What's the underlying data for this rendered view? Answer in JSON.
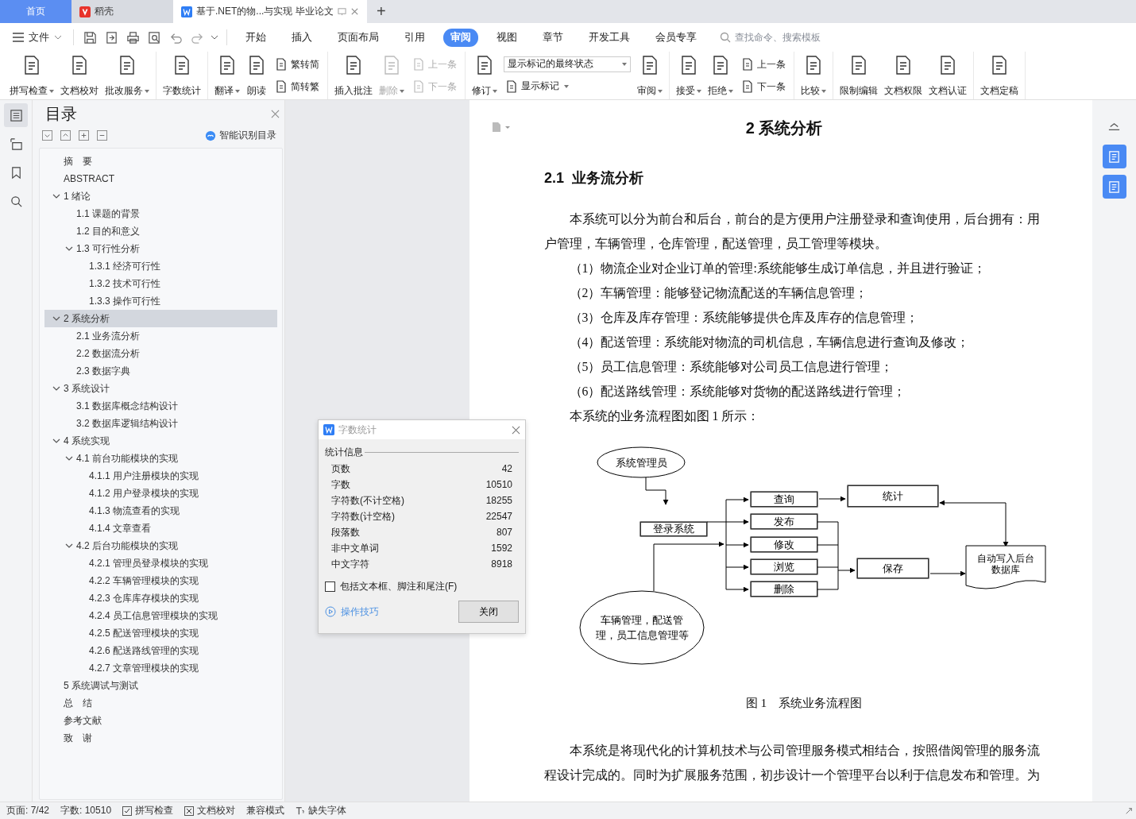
{
  "tab_bar": {
    "tabs": [
      {
        "label": "首页",
        "kind": "home",
        "selected": false
      },
      {
        "label": "稻壳",
        "kind": "app",
        "selected": false
      },
      {
        "label": "基于.NET的物...与实现 毕业论文",
        "kind": "doc",
        "selected": true
      }
    ],
    "new_tab": "+"
  },
  "menu_bar": {
    "file": "文件",
    "tabs": [
      {
        "label": "开始",
        "selected": false
      },
      {
        "label": "插入",
        "selected": false
      },
      {
        "label": "页面布局",
        "selected": false
      },
      {
        "label": "引用",
        "selected": false
      },
      {
        "label": "审阅",
        "selected": true
      },
      {
        "label": "视图",
        "selected": false
      },
      {
        "label": "章节",
        "selected": false
      },
      {
        "label": "开发工具",
        "selected": false
      },
      {
        "label": "会员专享",
        "selected": false
      }
    ],
    "search": {
      "placeholder": "查找命令、搜索模板"
    }
  },
  "ribbon": {
    "groups": [
      {
        "items": [
          {
            "kind": "large",
            "label": "拼写检查",
            "dropdown": true,
            "disabled": false
          },
          {
            "kind": "large",
            "label": "文档校对",
            "dropdown": false,
            "disabled": false
          },
          {
            "kind": "large",
            "label": "批改服务",
            "dropdown": true,
            "disabled": false
          }
        ]
      },
      {
        "items": [
          {
            "kind": "large",
            "label": "字数统计",
            "dropdown": false,
            "disabled": false
          }
        ]
      },
      {
        "items": [
          {
            "kind": "large",
            "label": "翻译",
            "dropdown": true,
            "disabled": false
          },
          {
            "kind": "large",
            "label": "朗读",
            "dropdown": false,
            "disabled": false
          },
          {
            "kind": "stack",
            "items": [
              {
                "kind": "small",
                "label": "繁转简",
                "dropdown": false,
                "disabled": false
              },
              {
                "kind": "small",
                "label": "简转繁",
                "dropdown": false,
                "disabled": false
              }
            ]
          }
        ]
      },
      {
        "items": [
          {
            "kind": "large",
            "label": "插入批注",
            "dropdown": false,
            "disabled": false
          },
          {
            "kind": "large",
            "label": "删除",
            "dropdown": true,
            "disabled": true
          },
          {
            "kind": "stack",
            "items": [
              {
                "kind": "small",
                "label": "上一条",
                "dropdown": false,
                "disabled": true
              },
              {
                "kind": "small",
                "label": "下一条",
                "dropdown": false,
                "disabled": true
              }
            ]
          }
        ]
      },
      {
        "items": [
          {
            "kind": "large",
            "label": "修订",
            "dropdown": true,
            "disabled": false
          },
          {
            "kind": "stack",
            "items": [
              {
                "kind": "select",
                "label": "显示标记的最终状态",
                "dropdown": true,
                "disabled": false
              },
              {
                "kind": "small",
                "label": "显示标记",
                "dropdown": true,
                "disabled": false
              }
            ]
          },
          {
            "kind": "large",
            "label": "审阅",
            "dropdown": true,
            "disabled": false
          }
        ]
      },
      {
        "items": [
          {
            "kind": "large",
            "label": "接受",
            "dropdown": true,
            "disabled": false
          },
          {
            "kind": "large",
            "label": "拒绝",
            "dropdown": true,
            "disabled": false
          },
          {
            "kind": "stack",
            "items": [
              {
                "kind": "small",
                "label": "上一条",
                "dropdown": false,
                "disabled": false
              },
              {
                "kind": "small",
                "label": "下一条",
                "dropdown": false,
                "disabled": false
              }
            ]
          }
        ]
      },
      {
        "items": [
          {
            "kind": "large",
            "label": "比较",
            "dropdown": true,
            "disabled": false
          }
        ]
      },
      {
        "items": [
          {
            "kind": "large",
            "label": "限制编辑",
            "dropdown": false,
            "disabled": false
          },
          {
            "kind": "large",
            "label": "文档权限",
            "dropdown": false,
            "disabled": false
          },
          {
            "kind": "large",
            "label": "文档认证",
            "dropdown": false,
            "disabled": false
          }
        ]
      },
      {
        "items": [
          {
            "kind": "large",
            "label": "文档定稿",
            "dropdown": false,
            "disabled": false
          }
        ]
      }
    ]
  },
  "left_rail": {
    "items": [
      {
        "selected": true
      },
      {
        "selected": false
      },
      {
        "selected": false
      },
      {
        "selected": false
      }
    ]
  },
  "toc": {
    "title": "目录",
    "smart_button": "智能识别目录",
    "items": [
      {
        "label": "摘　要",
        "selected": false
      },
      {
        "label": "ABSTRACT",
        "selected": false
      },
      {
        "label": "1 绪论",
        "selected": false,
        "expanded": true,
        "children": [
          {
            "label": "1.1  课题的背景",
            "selected": false
          },
          {
            "label": "1.2  目的和意义",
            "selected": false
          },
          {
            "label": "1.3  可行性分析",
            "selected": false,
            "expanded": true,
            "children": [
              {
                "label": "1.3.1 经济可行性",
                "selected": false
              },
              {
                "label": "1.3.2 技术可行性",
                "selected": false
              },
              {
                "label": "1.3.3 操作可行性",
                "selected": false
              }
            ]
          }
        ]
      },
      {
        "label": "2 系统分析",
        "selected": true,
        "expanded": true,
        "children": [
          {
            "label": "2.1  业务流分析",
            "selected": false
          },
          {
            "label": "2.2  数据流分析",
            "selected": false
          },
          {
            "label": "2.3  数据字典",
            "selected": false
          }
        ]
      },
      {
        "label": "3 系统设计",
        "selected": false,
        "expanded": true,
        "children": [
          {
            "label": "3.1 数据库概念结构设计",
            "selected": false
          },
          {
            "label": "3.2  数据库逻辑结构设计",
            "selected": false
          }
        ]
      },
      {
        "label": "4 系统实现",
        "selected": false,
        "expanded": true,
        "children": [
          {
            "label": "4.1 前台功能模块的实现",
            "selected": false,
            "expanded": true,
            "children": [
              {
                "label": "4.1.1  用户注册模块的实现",
                "selected": false
              },
              {
                "label": "4.1.2  用户登录模块的实现",
                "selected": false
              },
              {
                "label": "4.1.3  物流查看的实现",
                "selected": false
              },
              {
                "label": "4.1.4  文章查看",
                "selected": false
              }
            ]
          },
          {
            "label": "4.2 后台功能模块的实现",
            "selected": false,
            "expanded": true,
            "children": [
              {
                "label": "4.2.1  管理员登录模块的实现",
                "selected": false
              },
              {
                "label": "4.2.2  车辆管理模块的实现",
                "selected": false
              },
              {
                "label": "4.2.3  仓库库存模块的实现",
                "selected": false
              },
              {
                "label": "4.2.4  员工信息管理模块的实现",
                "selected": false
              },
              {
                "label": "4.2.5  配送管理模块的实现",
                "selected": false
              },
              {
                "label": "4.2.6  配送路线管理的实现",
                "selected": false
              },
              {
                "label": "4.2.7  文章管理模块的实现",
                "selected": false
              }
            ]
          }
        ]
      },
      {
        "label": "5  系统调试与测试",
        "selected": false
      },
      {
        "label": "总　结",
        "selected": false
      },
      {
        "label": "参考文献",
        "selected": false
      },
      {
        "label": "致　谢",
        "selected": false
      }
    ]
  },
  "document": {
    "heading": "2 系统分析",
    "section": {
      "number": "2.1",
      "title": "业务流分析"
    },
    "paragraphs": [
      "本系统可以分为前台和后台，前台的是方便用户注册登录和查询使用，后台拥有：用户管理，车辆管理，仓库管理，配送管理，员工管理等模块。",
      "（1）物流企业对企业订单的管理:系统能够生成订单信息，并且进行验证；",
      "（2）车辆管理：能够登记物流配送的车辆信息管理；",
      "（3）仓库及库存管理：系统能够提供仓库及库存的信息管理；",
      "（4）配送管理：系统能对物流的司机信息，车辆信息进行查询及修改；",
      "（5）员工信息管理：系统能够对公司员工信息进行管理；",
      "（6）配送路线管理：系统能够对货物的配送路线进行管理；",
      "本系统的业务流程图如图 1 所示："
    ],
    "flowchart": {
      "nodes": [
        {
          "kind": "ellipse",
          "label": "系统管理员"
        },
        {
          "kind": "box",
          "label": "登录系统"
        },
        {
          "kind": "box",
          "label": "查询"
        },
        {
          "kind": "box",
          "label": "发布"
        },
        {
          "kind": "box",
          "label": "修改"
        },
        {
          "kind": "box",
          "label": "浏览"
        },
        {
          "kind": "box",
          "label": "删除"
        },
        {
          "kind": "box",
          "label": "统计"
        },
        {
          "kind": "box",
          "label": "保存"
        },
        {
          "kind": "database",
          "label": "自动写入后台数据库"
        },
        {
          "kind": "ellipse",
          "label": "车辆管理，配送管理，员工信息管理等"
        }
      ]
    },
    "caption": "图 1　系统业务流程图",
    "after": [
      "本系统是将现代化的计算机技术与公司管理服务模式相结合，按照借阅管理的服务流程设计完成的。同时为扩展服务范围，初步设计一个管理平台以利于信息发布和管理。为"
    ]
  },
  "right_rail": {
    "items": [
      {
        "kind": "plain"
      },
      {
        "kind": "accent"
      },
      {
        "kind": "accent"
      }
    ]
  },
  "dialog": {
    "title": "字数统计",
    "section": "统计信息",
    "rows": [
      {
        "label": "页数",
        "value": "42"
      },
      {
        "label": "字数",
        "value": "10510"
      },
      {
        "label": "字符数(不计空格)",
        "value": "18255"
      },
      {
        "label": "字符数(计空格)",
        "value": "22547"
      },
      {
        "label": "段落数",
        "value": "807"
      },
      {
        "label": "非中文单词",
        "value": "1592"
      },
      {
        "label": "中文字符",
        "value": "8918"
      }
    ],
    "checkbox": {
      "label": "包括文本框、脚注和尾注(F)",
      "checked": false
    },
    "help_link": "操作技巧",
    "close_button": "关闭"
  },
  "status_bar": {
    "items": [
      {
        "kind": "text",
        "label": "页面: 7/42"
      },
      {
        "kind": "text",
        "label": "字数: 10510"
      },
      {
        "kind": "check",
        "label": "拼写检查"
      },
      {
        "kind": "cross",
        "label": "文档校对"
      },
      {
        "kind": "text",
        "label": "兼容模式"
      },
      {
        "kind": "font",
        "label": "缺失字体"
      }
    ]
  }
}
